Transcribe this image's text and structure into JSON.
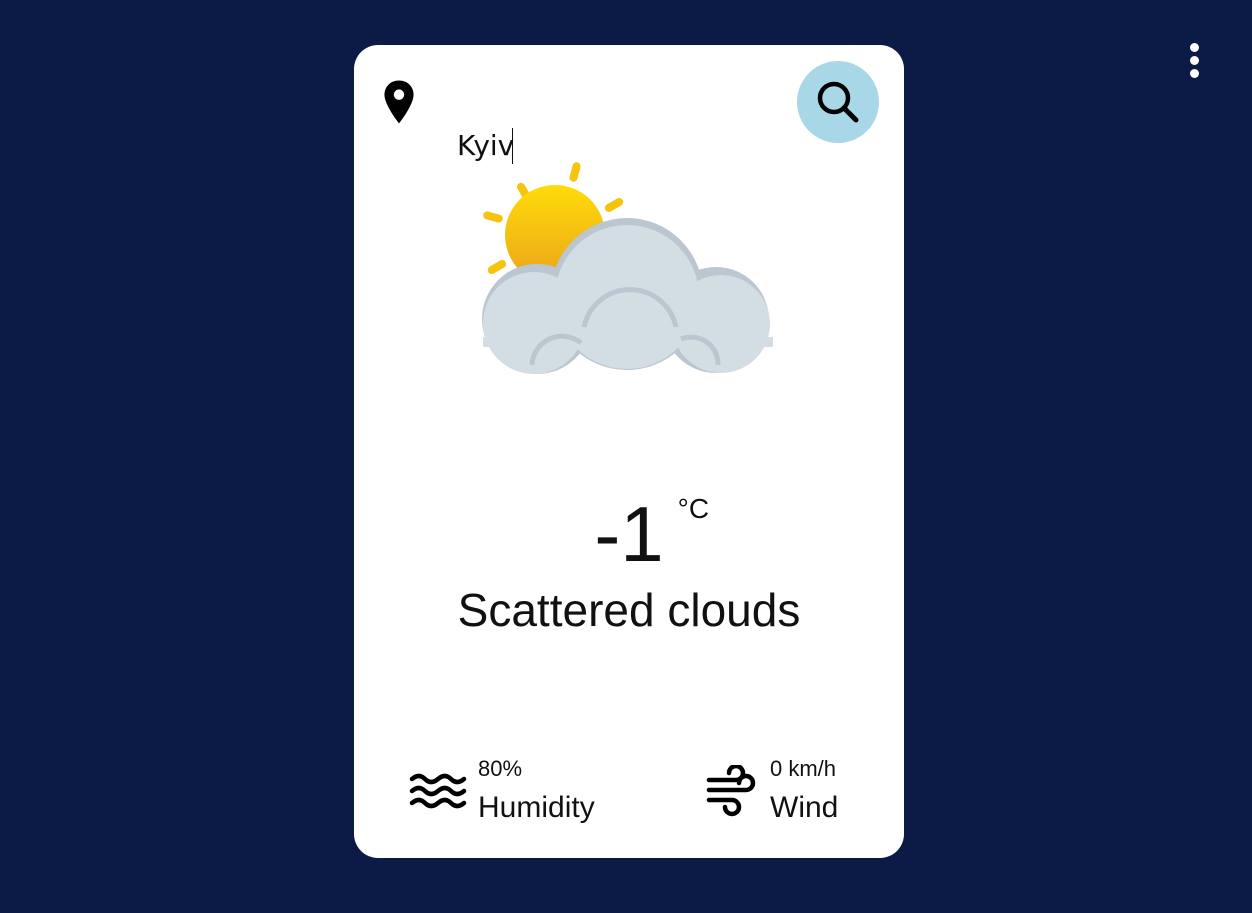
{
  "search": {
    "value": "Kyiv",
    "placeholder": ""
  },
  "weather": {
    "temperature": "-1",
    "unit": "°C",
    "description": "Scattered clouds",
    "icon": "sun-behind-cloud-icon"
  },
  "stats": {
    "humidity": {
      "value": "80%",
      "label": "Humidity",
      "icon": "humidity-waves-icon"
    },
    "wind": {
      "value": "0 km/h",
      "label": "Wind",
      "icon": "wind-icon"
    }
  },
  "colors": {
    "background": "#0c1a46",
    "card": "#ffffff",
    "search_button": "#a8d8e8",
    "sun": "#f6c40f",
    "cloud": "#d3dde4"
  }
}
